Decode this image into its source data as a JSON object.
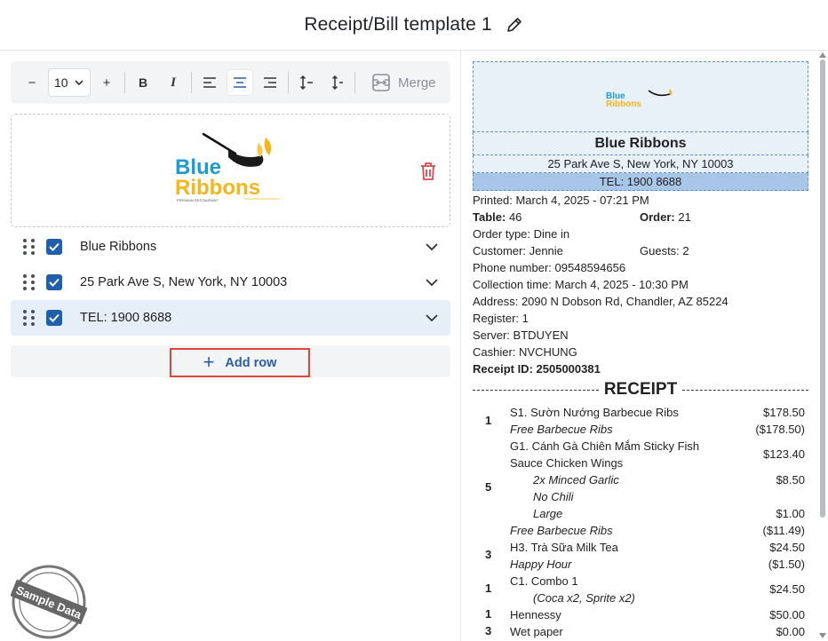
{
  "header": {
    "title": "Receipt/Bill template 1",
    "edit_icon": "pencil-icon"
  },
  "toolbar": {
    "decrease": "−",
    "font_size": "10",
    "increase": "+",
    "bold": "B",
    "italic": "I",
    "merge_label": "Merge"
  },
  "rows": [
    {
      "label": "Blue Ribbons",
      "checked": true
    },
    {
      "label": "25 Park Ave S, New York, NY 10003",
      "checked": true
    },
    {
      "label": "TEL: 1900 8688",
      "checked": true
    }
  ],
  "add_row_label": "Add row",
  "logo": {
    "line1": "Blue",
    "line2": "Ribbons",
    "tagline": "PREMIUM RESTAURANT"
  },
  "stamp_text": "Sample Data",
  "preview": {
    "name": "Blue Ribbons",
    "address": "25 Park Ave S, New York, NY 10003",
    "tel": "TEL: 1900 8688",
    "printed_label": "Printed:",
    "printed_value": "March 4, 2025 - 07:21 PM",
    "table_label": "Table:",
    "table_value": "46",
    "order_label": "Order:",
    "order_value": "21",
    "order_type_label": "Order type:",
    "order_type_value": "Dine in",
    "customer_label": "Customer:",
    "customer_value": "Jennie",
    "guests_label": "Guests:",
    "guests_value": "2",
    "phone_label": "Phone number:",
    "phone_value": "09548594656",
    "collection_label": "Collection time:",
    "collection_value": "March 4, 2025 - 10:30 PM",
    "address_label": "Address:",
    "address_value": "2090 N Dobson Rd, Chandler, AZ 85224",
    "register_label": "Register:",
    "register_value": "1",
    "server_label": "Server:",
    "server_value": "BTDUYEN",
    "cashier_label": "Cashier:",
    "cashier_value": "NVCHUNG",
    "receipt_id_label": "Receipt ID:",
    "receipt_id_value": "2505000381",
    "receipt_heading": "RECEIPT",
    "items": {
      "q1": "1",
      "i1": "S1. Sườn Nướng Barbecue Ribs",
      "p1": "$178.50",
      "i1b": "Free Barbecue Ribs",
      "p1b": "($178.50)",
      "i2a": "G1. Cánh Gà Chiên Mắm Sticky Fish",
      "i2b": "Sauce Chicken Wings",
      "p2": "$123.40",
      "q2": "5",
      "m1": "2x Minced Garlic",
      "pm1": "$8.50",
      "m2": "No Chili",
      "m3": "Large",
      "pm3": "$1.00",
      "i2c": "Free Barbecue Ribs",
      "p2c": "($11.49)",
      "q3": "3",
      "i3": "H3. Trà Sữa Milk Tea",
      "p3": "$24.50",
      "i3b": "Happy Hour",
      "p3b": "($1.50)",
      "q4": "1",
      "i4": "C1. Combo 1",
      "i4b": "(Coca x2, Sprite x2)",
      "p4": "$24.50",
      "q5": "1",
      "i5": "Hennessy",
      "p5": "$50.00",
      "q6": "3",
      "i6": "Wet paper",
      "p6": "$0.00"
    }
  }
}
